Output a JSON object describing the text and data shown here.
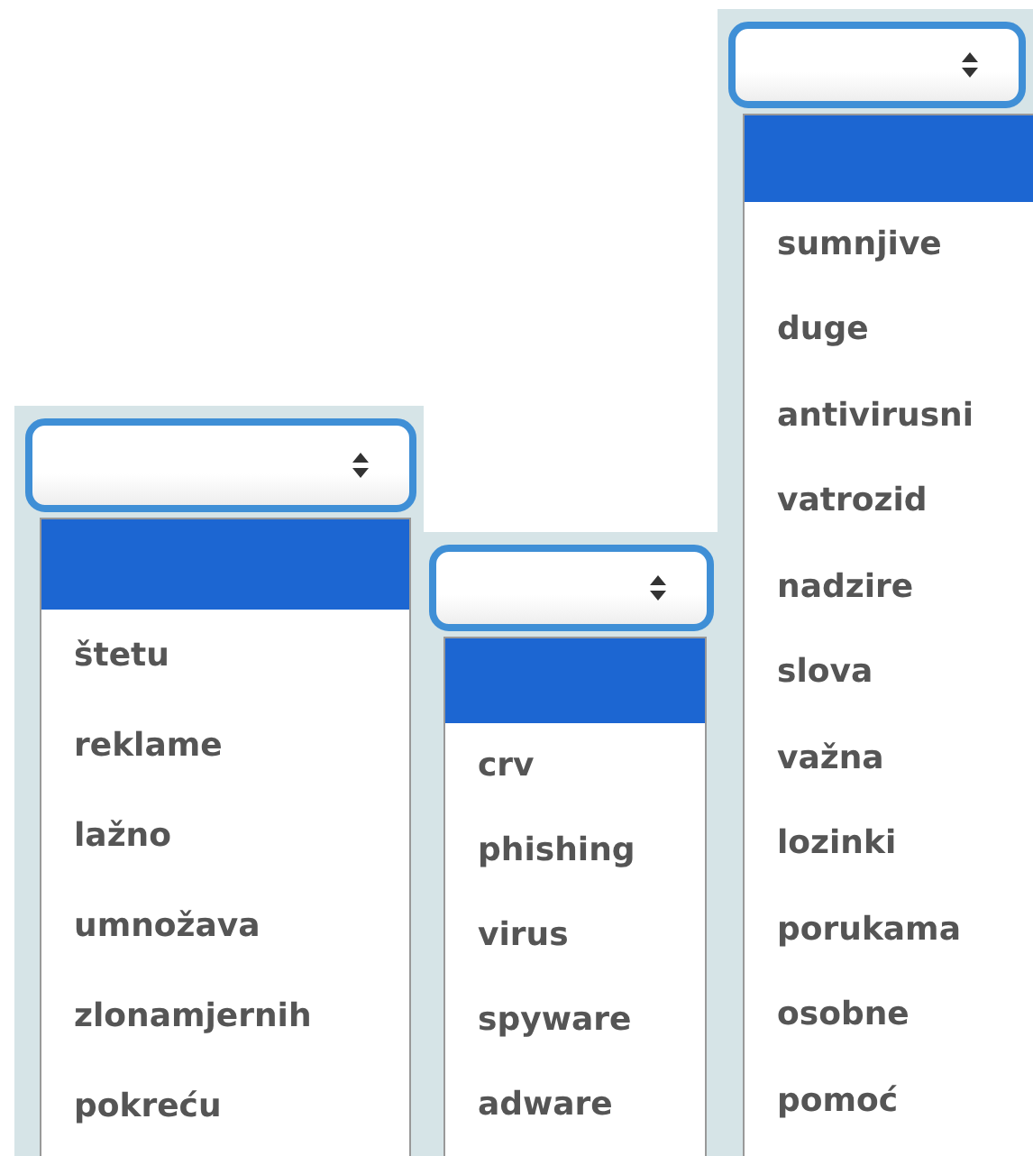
{
  "dropdowns": [
    {
      "blank_option": {
        "selected": true
      },
      "options": [
        {
          "label": "štetu",
          "selected": false
        },
        {
          "label": "reklame",
          "selected": false
        },
        {
          "label": "lažno",
          "selected": false
        },
        {
          "label": "umnožava",
          "selected": false
        },
        {
          "label": "zlonamjernih",
          "selected": false
        },
        {
          "label": "pokreću",
          "selected": false
        }
      ]
    },
    {
      "blank_option": {
        "selected": true
      },
      "options": [
        {
          "label": "crv",
          "selected": false
        },
        {
          "label": "phishing",
          "selected": false
        },
        {
          "label": "virus",
          "selected": false
        },
        {
          "label": "spyware",
          "selected": false
        },
        {
          "label": "adware",
          "selected": false
        }
      ]
    },
    {
      "blank_option": {
        "selected": true
      },
      "options": [
        {
          "label": "sumnjive",
          "selected": false
        },
        {
          "label": "duge",
          "selected": false
        },
        {
          "label": "antivirusni",
          "selected": false
        },
        {
          "label": "vatrozid",
          "selected": false
        },
        {
          "label": "nadzire",
          "selected": false
        },
        {
          "label": "slova",
          "selected": false
        },
        {
          "label": "važna",
          "selected": false
        },
        {
          "label": "lozinki",
          "selected": false
        },
        {
          "label": "porukama",
          "selected": false
        },
        {
          "label": "osobne",
          "selected": false
        },
        {
          "label": "pomoć",
          "selected": false
        }
      ]
    }
  ]
}
